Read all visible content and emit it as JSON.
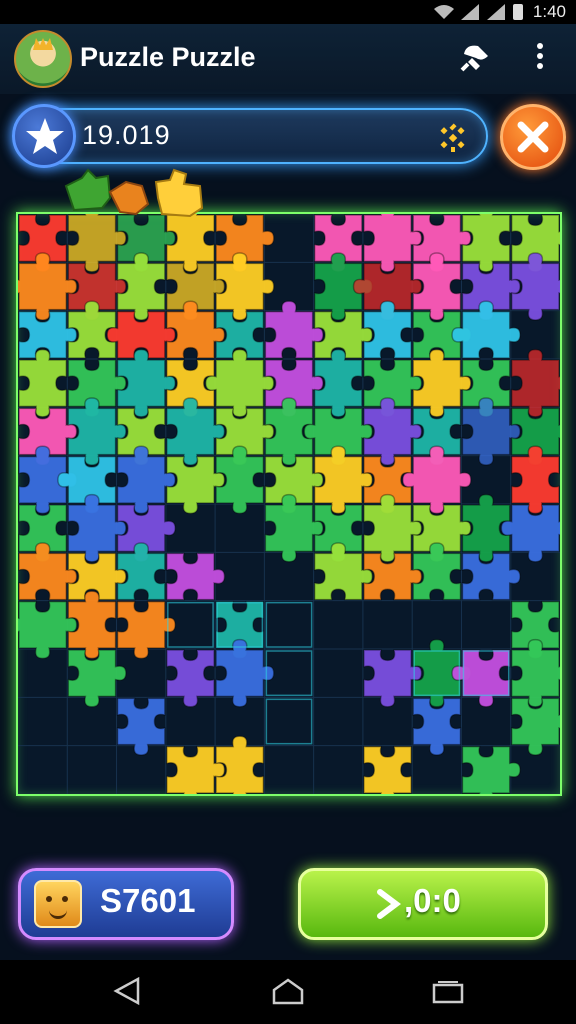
{
  "status_bar": {
    "time": "1:40"
  },
  "app_bar": {
    "title": "Puzzle Puzzle",
    "tool_icon": "brush-icon",
    "menu_icon": "more-vert-icon"
  },
  "field": {
    "value": "19.019",
    "left_icon": "star-icon",
    "right_icon": "sparkle-icon",
    "action_icon": "close-icon"
  },
  "colors": {
    "accent_blue": "#4fb3ff",
    "board_border": "#7dff6a",
    "close_orange": "#f25c12",
    "next_green": "#8fe23a",
    "coin_border": "#d48bff"
  },
  "board": {
    "columns": 11,
    "rows": 12,
    "piece_palette": [
      "#ff3b2f",
      "#ff8a1e",
      "#ffcf24",
      "#9be13a",
      "#34c759",
      "#1fb6a8",
      "#2fc4e8",
      "#3a6fe0",
      "#7b4fe0",
      "#c54fe0",
      "#ff5ab8",
      "#e42b2b",
      "#15a34a"
    ],
    "grid": [
      "aCEcb.kkkdd",
      "bAdCc.nLkii",
      "gdabfjdgeg ",
      "defcdjfeceL",
      "kfdfdeeifHm",
      "hghdedcbk.n",
      "ehi..eeddmn",
      "bcfj..dbeh.",
      "ebb.f.....e",
      ".e.ih..imje",
      "..h.....h.e",
      "...cc..c.e."
    ]
  },
  "bottom": {
    "coins": "S7601",
    "coin_icon": "treasure-face-icon",
    "next_label": ",0:0",
    "next_icon": "arrow-right-icon"
  },
  "nav": {
    "back_icon": "back-icon",
    "home_icon": "home-icon",
    "recent_icon": "recent-apps-icon"
  }
}
